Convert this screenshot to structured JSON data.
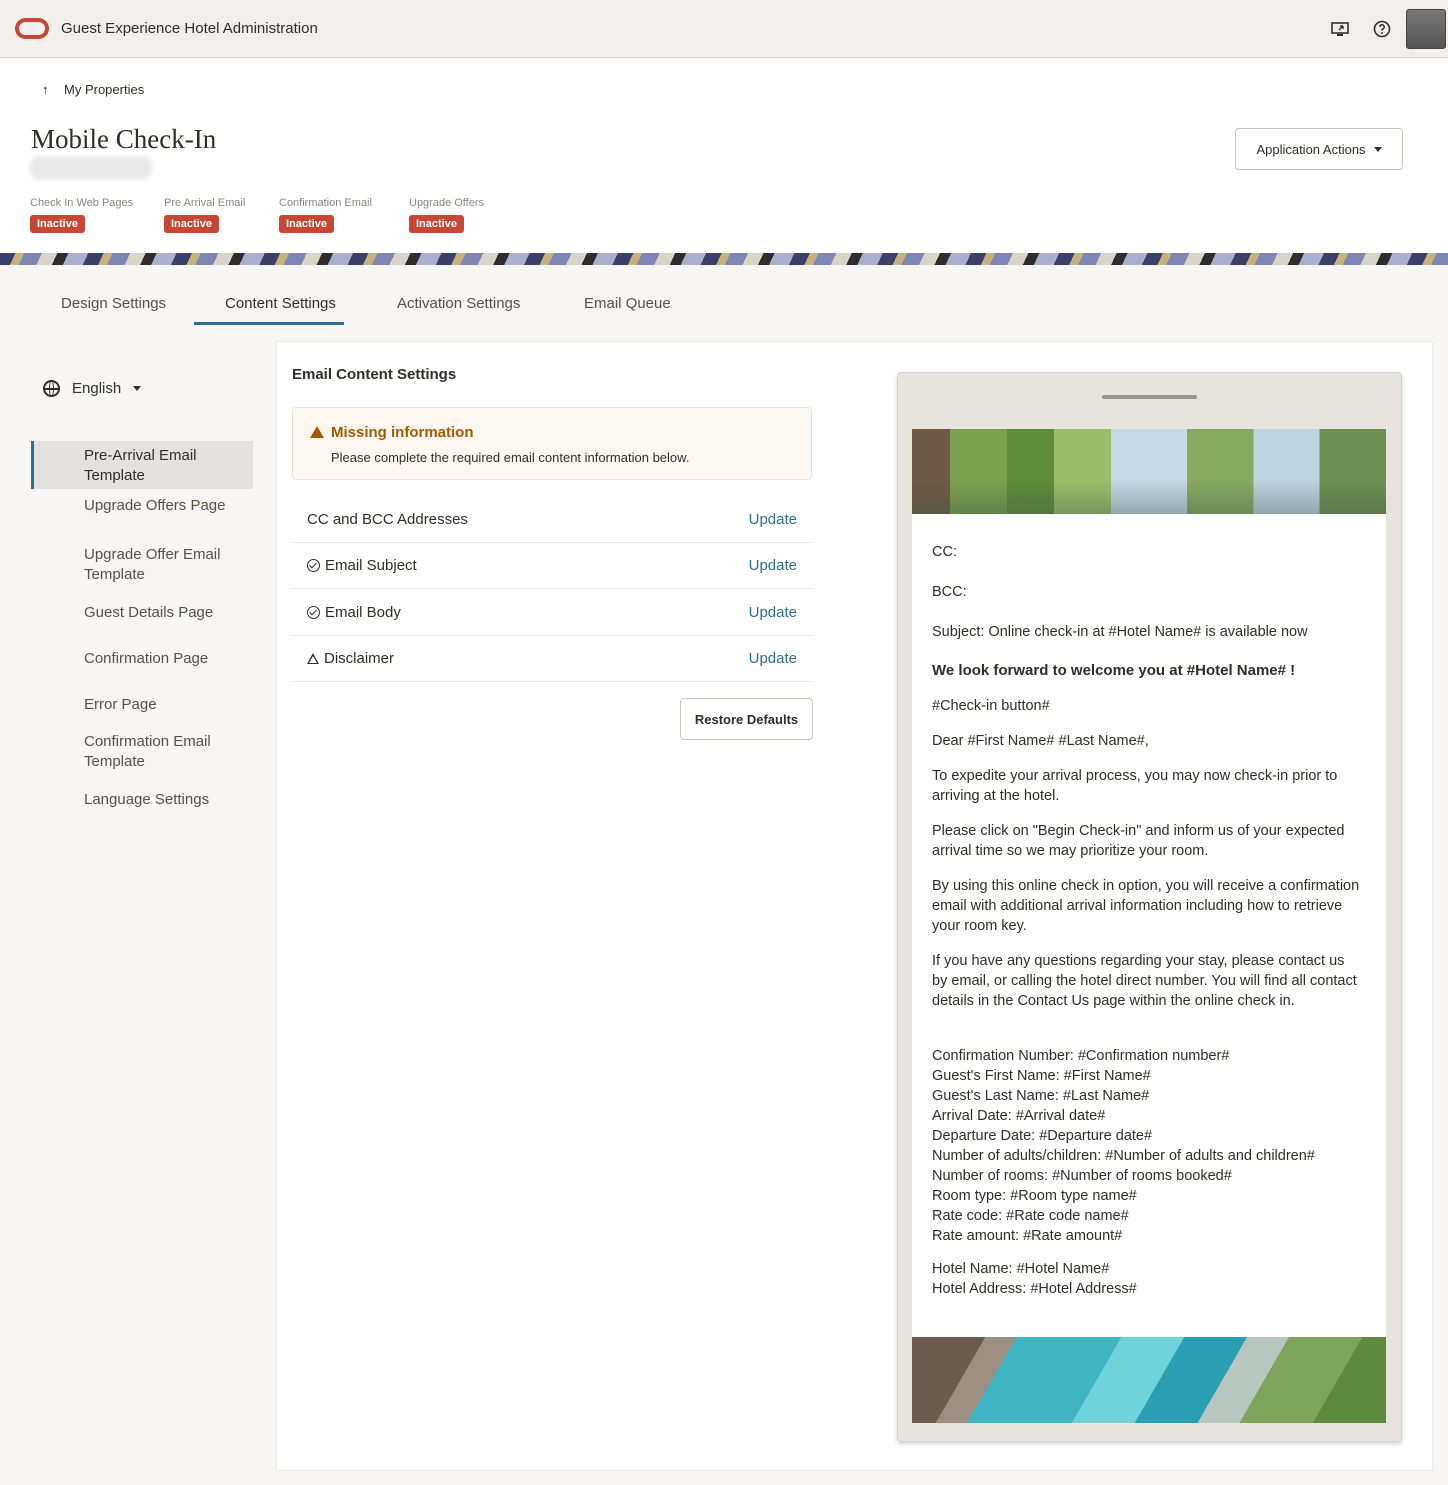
{
  "header": {
    "app_title": "Guest Experience Hotel Administration",
    "icons": [
      "screen-share-icon",
      "help-icon",
      "user-avatar"
    ]
  },
  "breadcrumb": {
    "label": "My Properties"
  },
  "page": {
    "title": "Mobile Check-In"
  },
  "statuses": [
    {
      "label": "Check In Web Pages",
      "badge": "Inactive"
    },
    {
      "label": "Pre Arrival Email",
      "badge": "Inactive"
    },
    {
      "label": "Confirmation Email",
      "badge": "Inactive"
    },
    {
      "label": "Upgrade Offers",
      "badge": "Inactive"
    }
  ],
  "actions": {
    "application_actions": "Application Actions"
  },
  "tabs": [
    {
      "label": "Design Settings"
    },
    {
      "label": "Content Settings",
      "active": true
    },
    {
      "label": "Activation Settings"
    },
    {
      "label": "Email Queue"
    }
  ],
  "language": {
    "selected": "English"
  },
  "nav": [
    {
      "label": "Pre-Arrival Email Template",
      "active": true
    },
    {
      "label": "Upgrade Offers Page"
    },
    {
      "label": "Upgrade Offer Email Template"
    },
    {
      "label": "Guest Details Page"
    },
    {
      "label": "Confirmation Page"
    },
    {
      "label": "Error Page"
    },
    {
      "label": "Confirmation Email Template"
    },
    {
      "label": "Language Settings"
    }
  ],
  "content": {
    "section_title": "Email Content Settings",
    "warning": {
      "title": "Missing information",
      "text": "Please complete the required email content information below."
    },
    "rows": [
      {
        "label": "CC and BCC Addresses",
        "icon": "none",
        "link": "Update"
      },
      {
        "label": "Email Subject",
        "icon": "check-circle-icon",
        "link": "Update"
      },
      {
        "label": "Email Body",
        "icon": "check-circle-icon",
        "link": "Update"
      },
      {
        "label": "Disclaimer",
        "icon": "warning-icon",
        "link": "Update"
      }
    ],
    "restore_label": "Restore Defaults"
  },
  "preview": {
    "cc": "CC:",
    "bcc": "BCC:",
    "subject": "Subject: Online check-in at #Hotel Name# is available now",
    "heading": "We look forward to welcome you at #Hotel Name# !",
    "checkin_button": "#Check-in button#",
    "greeting": "Dear #First Name# #Last Name#,",
    "p1": "To expedite your arrival process, you may now check-in prior to arriving at the hotel.",
    "p2": "Please click on \"Begin Check-in\" and inform us of your expected arrival time so we may prioritize your room.",
    "p3": "By using this online check in option, you will receive a confirmation email with additional arrival information including how to retrieve your room key.",
    "p4": "If you have any questions regarding your stay, please contact us by email, or calling the hotel direct number. You will find all contact details in the Contact Us page within the online check in.",
    "details": [
      "Confirmation Number: #Confirmation number#",
      "Guest's First Name: #First Name#",
      "Guest's Last Name: #Last Name#",
      "Arrival Date: #Arrival date#",
      "Departure Date: #Departure date#",
      "Number of adults/children: #Number of adults and children#",
      "Number of rooms: #Number of rooms booked#",
      "Room type: #Room type name#",
      "Rate code: #Rate code name#",
      "Rate amount: #Rate amount#"
    ],
    "hotel": [
      "Hotel Name: #Hotel Name#",
      "Hotel Address: #Hotel Address#"
    ]
  }
}
